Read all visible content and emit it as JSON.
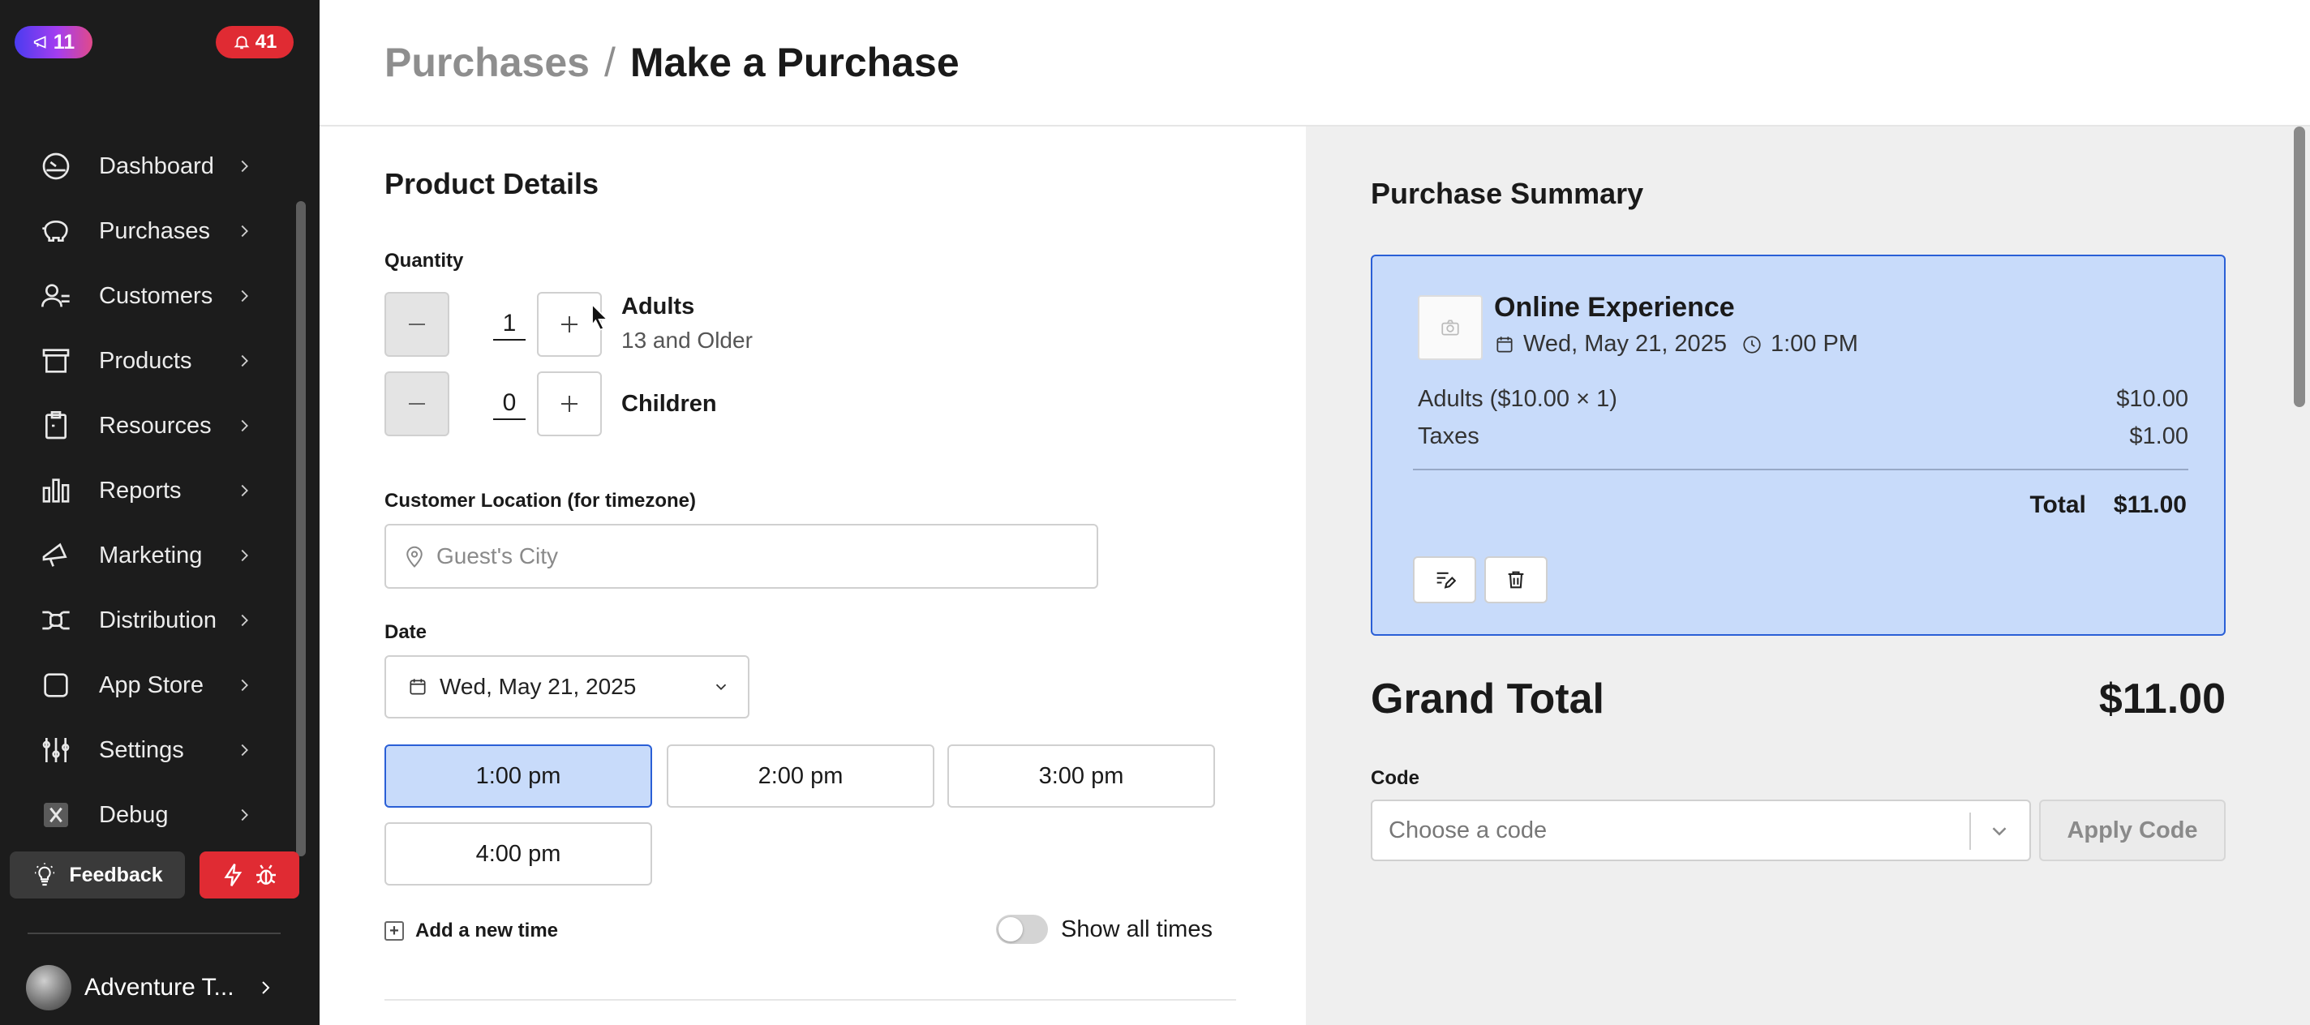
{
  "sidebar": {
    "promo_badge": "11",
    "alert_badge": "41",
    "items": [
      {
        "label": "Dashboard",
        "icon": "gauge-icon"
      },
      {
        "label": "Purchases",
        "icon": "piggy-bank-icon"
      },
      {
        "label": "Customers",
        "icon": "users-icon"
      },
      {
        "label": "Products",
        "icon": "archive-box-icon"
      },
      {
        "label": "Resources",
        "icon": "clipboard-icon"
      },
      {
        "label": "Reports",
        "icon": "bar-chart-icon"
      },
      {
        "label": "Marketing",
        "icon": "megaphone-icon"
      },
      {
        "label": "Distribution",
        "icon": "distribution-icon"
      },
      {
        "label": "App Store",
        "icon": "app-square-icon"
      },
      {
        "label": "Settings",
        "icon": "sliders-icon"
      },
      {
        "label": "Debug",
        "icon": "debug-x-icon"
      }
    ],
    "feedback_label": "Feedback",
    "account_name": "Adventure T..."
  },
  "header": {
    "parent": "Purchases",
    "separator": "/",
    "current": "Make a Purchase"
  },
  "form": {
    "section_title": "Product Details",
    "quantity_label": "Quantity",
    "tickets": [
      {
        "qty": "1",
        "name": "Adults",
        "sub": "13 and Older"
      },
      {
        "qty": "0",
        "name": "Children",
        "sub": ""
      }
    ],
    "location_label": "Customer Location (for timezone)",
    "location_placeholder": "Guest's City",
    "date_label": "Date",
    "date_value": "Wed, May 21, 2025",
    "times": [
      "1:00 pm",
      "2:00 pm",
      "3:00 pm",
      "4:00 pm"
    ],
    "selected_time": "1:00 pm",
    "add_time_label": "Add a new time",
    "show_all_label": "Show all times",
    "show_all_on": false
  },
  "summary": {
    "title": "Purchase Summary",
    "product_name": "Online Experience",
    "product_date": "Wed, May 21, 2025",
    "product_time": "1:00 PM",
    "lines": [
      {
        "label": "Adults ($10.00 × 1)",
        "amount": "$10.00"
      },
      {
        "label": "Taxes",
        "amount": "$1.00"
      }
    ],
    "total_label": "Total",
    "total_value": "$11.00",
    "grand_total_label": "Grand Total",
    "grand_total_value": "$11.00",
    "code_label": "Code",
    "code_placeholder": "Choose a code",
    "apply_label": "Apply Code"
  },
  "colors": {
    "sidebar_bg": "#1c1c1c",
    "accent_blue": "#2a5fd6",
    "selected_bg": "#c8dbfa",
    "alert_red": "#e02b33"
  }
}
